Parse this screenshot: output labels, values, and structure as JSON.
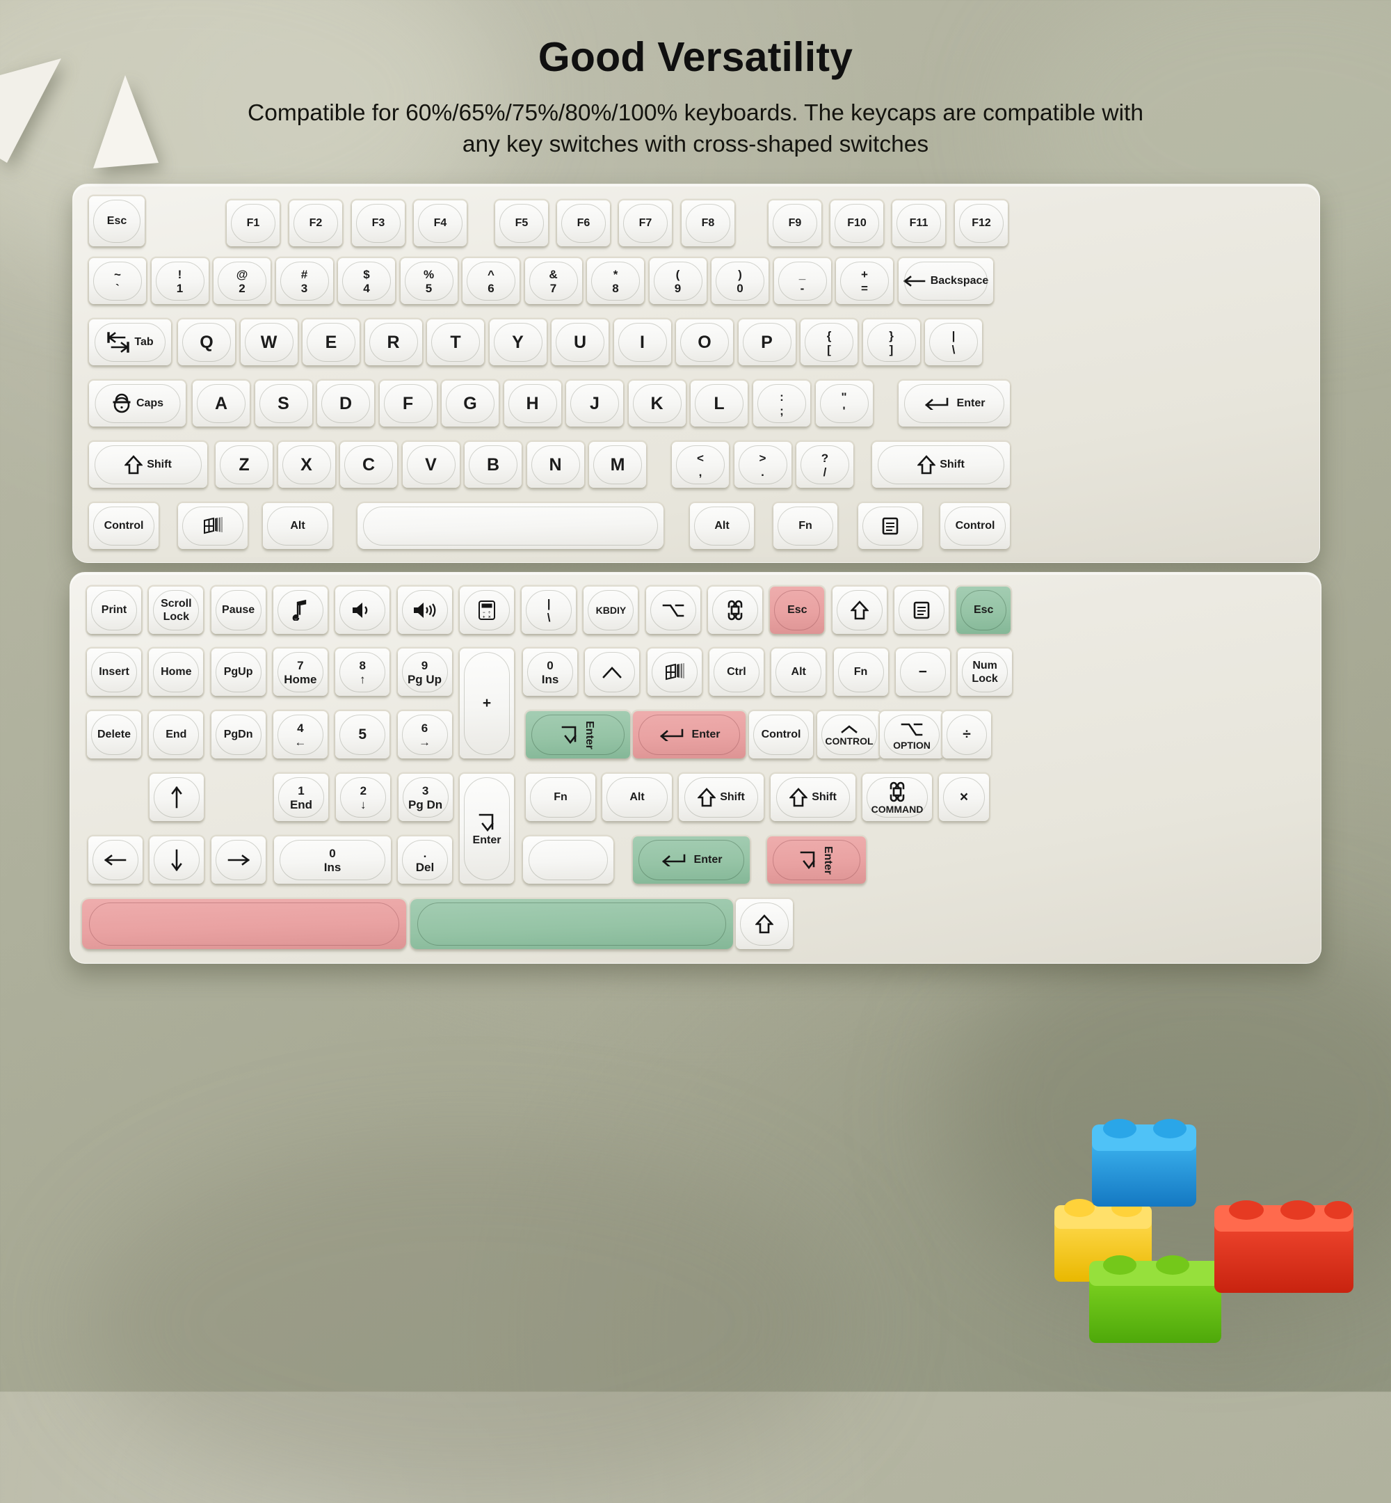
{
  "header": {
    "title": "Good Versatility",
    "subtitle": "Compatible for 60%/65%/75%/80%/100% keyboards. The keycaps are compatible with any key switches with cross-shaped switches"
  },
  "colors": {
    "background": "#aeb09c",
    "plate": "#efeee7",
    "keycap": "#f7f7f4",
    "accent_green": "#96c4a6",
    "accent_pink": "#e9a2a2",
    "legend": "#1b1b1b"
  },
  "keyboards": [
    {
      "name": "top-keyboard",
      "rows": [
        {
          "name": "function-row",
          "keys": [
            {
              "label": "Esc"
            },
            {
              "label": "F1"
            },
            {
              "label": "F2"
            },
            {
              "label": "F3"
            },
            {
              "label": "F4"
            },
            {
              "label": "F5"
            },
            {
              "label": "F6"
            },
            {
              "label": "F7"
            },
            {
              "label": "F8"
            },
            {
              "label": "F9"
            },
            {
              "label": "F10"
            },
            {
              "label": "F11"
            },
            {
              "label": "F12"
            }
          ]
        },
        {
          "name": "number-row",
          "keys": [
            {
              "top": "~",
              "bottom": "`"
            },
            {
              "top": "!",
              "bottom": "1"
            },
            {
              "top": "@",
              "bottom": "2"
            },
            {
              "top": "#",
              "bottom": "3"
            },
            {
              "top": "$",
              "bottom": "4"
            },
            {
              "top": "%",
              "bottom": "5"
            },
            {
              "top": "^",
              "bottom": "6"
            },
            {
              "top": "&",
              "bottom": "7"
            },
            {
              "top": "*",
              "bottom": "8"
            },
            {
              "top": "(",
              "bottom": "9"
            },
            {
              "top": ")",
              "bottom": "0"
            },
            {
              "top": "_",
              "bottom": "-"
            },
            {
              "top": "+",
              "bottom": "="
            },
            {
              "label": "Backspace",
              "icon": "arrow-left-icon"
            }
          ]
        },
        {
          "name": "qwerty-row",
          "keys": [
            {
              "label": "Tab",
              "icon": "tab-arrows-icon"
            },
            {
              "label": "Q"
            },
            {
              "label": "W"
            },
            {
              "label": "E"
            },
            {
              "label": "R"
            },
            {
              "label": "T"
            },
            {
              "label": "Y"
            },
            {
              "label": "U"
            },
            {
              "label": "I"
            },
            {
              "label": "O"
            },
            {
              "label": "P"
            },
            {
              "top": "{",
              "bottom": "["
            },
            {
              "top": "}",
              "bottom": "]"
            },
            {
              "top": "|",
              "bottom": "\\"
            }
          ]
        },
        {
          "name": "home-row",
          "keys": [
            {
              "label": "Caps",
              "icon": "caps-lock-icon"
            },
            {
              "label": "A"
            },
            {
              "label": "S"
            },
            {
              "label": "D"
            },
            {
              "label": "F"
            },
            {
              "label": "G"
            },
            {
              "label": "H"
            },
            {
              "label": "J"
            },
            {
              "label": "K"
            },
            {
              "label": "L"
            },
            {
              "top": ":",
              "bottom": ";"
            },
            {
              "top": "\"",
              "bottom": "'"
            },
            {
              "label": "Enter",
              "icon": "enter-arrow-icon"
            }
          ]
        },
        {
          "name": "shift-row",
          "keys": [
            {
              "label": "Shift",
              "icon": "shift-arrow-icon"
            },
            {
              "label": "Z"
            },
            {
              "label": "X"
            },
            {
              "label": "C"
            },
            {
              "label": "V"
            },
            {
              "label": "B"
            },
            {
              "label": "N"
            },
            {
              "label": "M"
            },
            {
              "top": "<",
              "bottom": ","
            },
            {
              "top": ">",
              "bottom": "."
            },
            {
              "top": "?",
              "bottom": "/"
            },
            {
              "label": "Shift",
              "icon": "shift-arrow-icon"
            }
          ]
        },
        {
          "name": "modifier-row",
          "keys": [
            {
              "label": "Control"
            },
            {
              "label": "",
              "icon": "windows-flag-icon"
            },
            {
              "label": "Alt"
            },
            {
              "label": "",
              "icon": "spacebar"
            },
            {
              "label": "Alt"
            },
            {
              "label": "Fn"
            },
            {
              "label": "",
              "icon": "menu-icon"
            },
            {
              "label": "Control"
            }
          ]
        }
      ]
    },
    {
      "name": "bottom-keyboard",
      "rows": [
        {
          "name": "novelty-row",
          "keys": [
            {
              "label": "Print"
            },
            {
              "label": "Scroll Lock",
              "l1": "Scroll",
              "l2": "Lock"
            },
            {
              "label": "Pause"
            },
            {
              "label": "",
              "icon": "music-note-icon"
            },
            {
              "label": "",
              "icon": "volume-low-icon"
            },
            {
              "label": "",
              "icon": "volume-high-icon"
            },
            {
              "label": "",
              "icon": "calculator-icon"
            },
            {
              "top": "|",
              "bottom": "\\"
            },
            {
              "label": "KBDIY"
            },
            {
              "label": "",
              "icon": "option-icon"
            },
            {
              "label": "",
              "icon": "command-icon"
            },
            {
              "label": "Esc",
              "color": "pink"
            },
            {
              "label": "",
              "icon": "shift-arrow-icon"
            },
            {
              "label": "",
              "icon": "menu-icon"
            },
            {
              "label": "Esc",
              "color": "green"
            }
          ]
        },
        {
          "name": "nav-numpad-row-1",
          "keys": [
            {
              "label": "Insert"
            },
            {
              "label": "Home"
            },
            {
              "label": "PgUp"
            },
            {
              "top": "7",
              "bottom": "Home"
            },
            {
              "top": "8",
              "bottom": "↑"
            },
            {
              "top": "9",
              "bottom": "Pg Up"
            },
            {
              "label": "+"
            },
            {
              "top": "0",
              "bottom": "Ins"
            },
            {
              "label": "",
              "icon": "chevron-up-icon"
            },
            {
              "label": "",
              "icon": "windows-flag-icon"
            },
            {
              "label": "Ctrl"
            },
            {
              "label": "Alt"
            },
            {
              "label": "Fn"
            },
            {
              "label": "−"
            },
            {
              "label": "Num Lock",
              "l1": "Num",
              "l2": "Lock"
            }
          ]
        },
        {
          "name": "nav-numpad-row-2",
          "keys": [
            {
              "label": "Delete"
            },
            {
              "label": "End"
            },
            {
              "label": "PgDn"
            },
            {
              "top": "4",
              "bottom": "←"
            },
            {
              "label": "5"
            },
            {
              "top": "6",
              "bottom": "→"
            },
            {
              "label": "Enter",
              "color": "green",
              "icon": "enter-down-icon"
            },
            {
              "label": "Enter",
              "color": "pink",
              "icon": "enter-arrow-icon"
            },
            {
              "label": "Control"
            },
            {
              "label": "CONTROL",
              "icon": "control-caret-icon"
            },
            {
              "label": "OPTION",
              "icon": "option-icon"
            },
            {
              "label": "÷"
            }
          ]
        },
        {
          "name": "nav-numpad-row-3",
          "keys": [
            {
              "label": "",
              "icon": "arrow-up-icon"
            },
            {
              "top": "1",
              "bottom": "End"
            },
            {
              "top": "2",
              "bottom": "↓"
            },
            {
              "top": "3",
              "bottom": "Pg Dn"
            },
            {
              "label": "Enter",
              "icon": "enter-arrow-icon"
            },
            {
              "label": "Fn"
            },
            {
              "label": "Alt"
            },
            {
              "label": "Shift",
              "icon": "shift-arrow-icon"
            },
            {
              "label": "Shift",
              "icon": "shift-arrow-icon"
            },
            {
              "label": "COMMAND",
              "icon": "command-icon"
            },
            {
              "label": "×"
            }
          ]
        },
        {
          "name": "arrow-row",
          "keys": [
            {
              "label": "",
              "icon": "arrow-left-icon"
            },
            {
              "label": "",
              "icon": "arrow-down-icon"
            },
            {
              "label": "",
              "icon": "arrow-right-icon"
            },
            {
              "top": "0",
              "bottom": "Ins"
            },
            {
              "top": ".",
              "bottom": "Del"
            },
            {
              "label": "Enter",
              "icon": "enter-down-icon"
            },
            {
              "label": "",
              "icon": "spacebar"
            },
            {
              "label": "Enter",
              "color": "green",
              "icon": "enter-arrow-icon"
            },
            {
              "label": "Enter",
              "color": "pink",
              "icon": "enter-down-icon"
            }
          ]
        },
        {
          "name": "spacebar-row",
          "keys": [
            {
              "label": "",
              "color": "pink",
              "icon": "spacebar"
            },
            {
              "label": "",
              "color": "green",
              "icon": "spacebar"
            },
            {
              "label": "",
              "icon": "shift-arrow-icon"
            }
          ]
        }
      ]
    }
  ]
}
